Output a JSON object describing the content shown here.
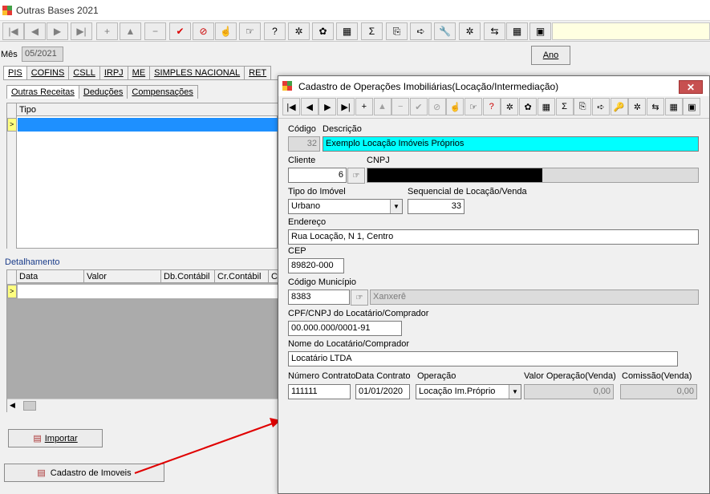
{
  "window": {
    "title": "Outras Bases 2021"
  },
  "toolbar": {
    "icons": [
      "first-icon",
      "prev-icon",
      "next-icon",
      "last-icon",
      "add-icon",
      "up-icon",
      "delete-icon",
      "confirm-icon",
      "cancel-icon",
      "hand-icon",
      "lookup-icon",
      "query-icon",
      "settings-icon",
      "refresh-icon",
      "export-icon",
      "sigma-icon",
      "copy-icon",
      "send-icon",
      "tools-icon",
      "process-icon",
      "transfer-icon",
      "calculator-icon",
      "stop-icon"
    ],
    "glyphs": [
      "|◀",
      "◀",
      "▶",
      "▶|",
      "+",
      "▲",
      "−",
      "✔",
      "⊘",
      "☝",
      "☞",
      "?",
      "✲",
      "✿",
      "▦",
      "Σ",
      "⎘",
      "➪",
      "🔧",
      "✲",
      "⇆",
      "▦",
      "▣"
    ]
  },
  "period": {
    "label": "Mês",
    "value": "05/2021",
    "ano_button": "Ano"
  },
  "tabs": [
    "PIS",
    "COFINS",
    "CSLL",
    "IRPJ",
    "ME",
    "SIMPLES NACIONAL",
    "RET"
  ],
  "subtabs": [
    "Outras Receitas",
    "Deduções",
    "Compensações"
  ],
  "grid1": {
    "header": "Tipo"
  },
  "detalhamento": {
    "label": "Detalhamento",
    "columns": [
      "Data",
      "Valor",
      "Db.Contábil",
      "Cr.Contábil",
      "C"
    ]
  },
  "buttons": {
    "importar": "Importar",
    "cadastro": "Cadastro de Imoveis"
  },
  "dialog": {
    "title": "Cadastro de Operações Imobiliárias(Locação/Intermediação)",
    "close": "✕",
    "toolbar": [
      "|◀",
      "◀",
      "▶",
      "▶|",
      "+",
      "▲",
      "−",
      "✔",
      "⊘",
      "☝",
      "☞",
      "?",
      "✲",
      "✿",
      "▦",
      "Σ",
      "⎘",
      "➪",
      "🔑",
      "✲",
      "⇆",
      "▦",
      "▣"
    ],
    "codigo_label": "Código",
    "codigo_value": "32",
    "descricao_label": "Descrição",
    "descricao_value": "Exemplo Locação Imóveis Próprios",
    "cliente_label": "Cliente",
    "cliente_value": "6",
    "cnpj_label": "CNPJ",
    "tipo_imovel_label": "Tipo do Imóvel",
    "tipo_imovel_value": "Urbano",
    "sequencial_label": "Sequencial de Locação/Venda",
    "sequencial_value": "33",
    "endereco_label": "Endereço",
    "endereco_value": "Rua Locação, N 1, Centro",
    "cep_label": "CEP",
    "cep_value": "89820-000",
    "municipio_label": "Código Município",
    "municipio_value": "8383",
    "municipio_nome": "Xanxerê",
    "cpf_label": "CPF/CNPJ do Locatário/Comprador",
    "cpf_value": "00.000.000/0001-91",
    "nome_label": "Nome do Locatário/Comprador",
    "nome_value": "Locatário LTDA",
    "numero_contrato_label": "Número Contrato",
    "numero_contrato_value": "111111",
    "data_contrato_label": "Data Contrato",
    "data_contrato_value": "01/01/2020",
    "operacao_label": "Operação",
    "operacao_value": "Locação Im.Próprio",
    "valor_operacao_label": "Valor Operação(Venda)",
    "valor_operacao_value": "0,00",
    "comissao_label": "Comissão(Venda)",
    "comissao_value": "0,00"
  },
  "colors": {
    "selection": "#1e90ff",
    "highlight": "#00ffff",
    "arrow": "#e00000",
    "close": "#c75050"
  }
}
